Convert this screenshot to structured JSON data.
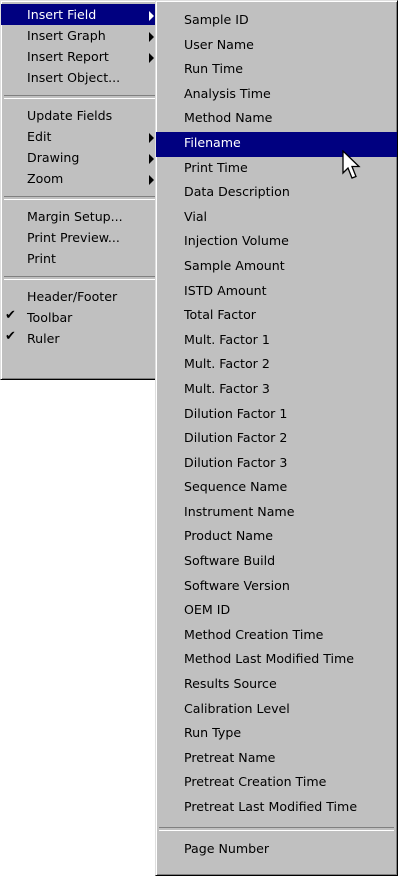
{
  "main_menu": {
    "groups": [
      [
        {
          "label": "Insert Field",
          "has_submenu": true,
          "selected": true
        },
        {
          "label": "Insert Graph",
          "has_submenu": true
        },
        {
          "label": "Insert Report",
          "has_submenu": true
        },
        {
          "label": "Insert Object...",
          "has_submenu": false
        }
      ],
      [
        {
          "label": "Update Fields",
          "has_submenu": false
        },
        {
          "label": "Edit",
          "has_submenu": true
        },
        {
          "label": "Drawing",
          "has_submenu": true
        },
        {
          "label": "Zoom",
          "has_submenu": true
        }
      ],
      [
        {
          "label": "Margin Setup...",
          "has_submenu": false
        },
        {
          "label": "Print Preview...",
          "has_submenu": false
        },
        {
          "label": "Print",
          "has_submenu": false
        }
      ],
      [
        {
          "label": "Header/Footer",
          "has_submenu": false
        },
        {
          "label": "Toolbar",
          "checked": true
        },
        {
          "label": "Ruler",
          "checked": true
        }
      ]
    ],
    "check_glyph": "✔"
  },
  "insert_field_submenu": {
    "items": [
      "Sample ID",
      "User Name",
      "Run Time",
      "Analysis Time",
      "Method Name",
      "Filename",
      "Print Time",
      "Data Description",
      "Vial",
      "Injection Volume",
      "Sample Amount",
      "ISTD Amount",
      "Total Factor",
      "Mult. Factor 1",
      "Mult. Factor 2",
      "Mult. Factor 3",
      "Dilution Factor 1",
      "Dilution Factor 2",
      "Dilution Factor 3",
      "Sequence Name",
      "Instrument Name",
      "Product Name",
      "Software Build",
      "Software Version",
      "OEM ID",
      "Method Creation Time",
      "Method Last Modified Time",
      "Results Source",
      "Calibration Level",
      "Run Type",
      "Pretreat Name",
      "Pretreat Creation Time",
      "Pretreat Last Modified Time"
    ],
    "selected_index": 5,
    "after_separator": [
      "Page Number"
    ]
  },
  "colors": {
    "menu_bg": "#c0c0c0",
    "highlight_bg": "#000080",
    "highlight_text": "#ffffff"
  },
  "cursor_icon": "arrow-pointer"
}
